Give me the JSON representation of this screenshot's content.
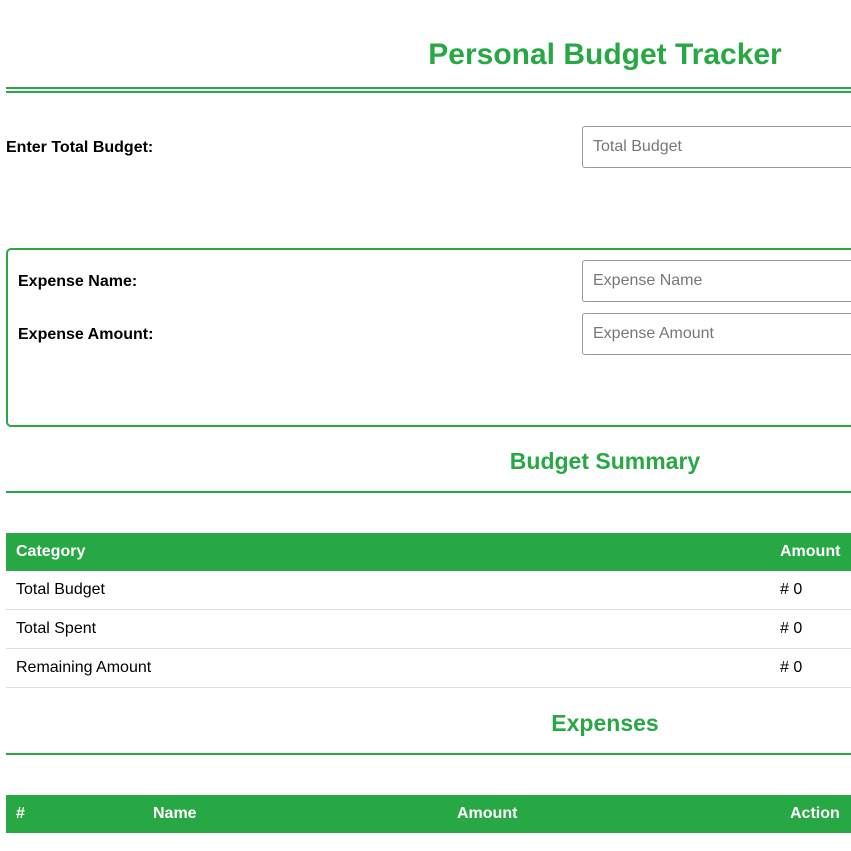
{
  "title": "Personal Budget Tracker",
  "budget": {
    "label": "Enter Total Budget:",
    "placeholder": "Total Budget"
  },
  "expense_form": {
    "name_label": "Expense Name:",
    "name_placeholder": "Expense Name",
    "amount_label": "Expense Amount:",
    "amount_placeholder": "Expense Amount"
  },
  "summary": {
    "heading": "Budget Summary",
    "columns": [
      "Category",
      "Amount"
    ],
    "rows": [
      {
        "category": "Total Budget",
        "amount": "# 0"
      },
      {
        "category": "Total Spent",
        "amount": "# 0"
      },
      {
        "category": "Remaining Amount",
        "amount": "# 0"
      }
    ]
  },
  "expenses": {
    "heading": "Expenses",
    "columns": [
      "#",
      "Name",
      "Amount",
      "Action"
    ]
  },
  "colors": {
    "accent": "#28a745"
  }
}
